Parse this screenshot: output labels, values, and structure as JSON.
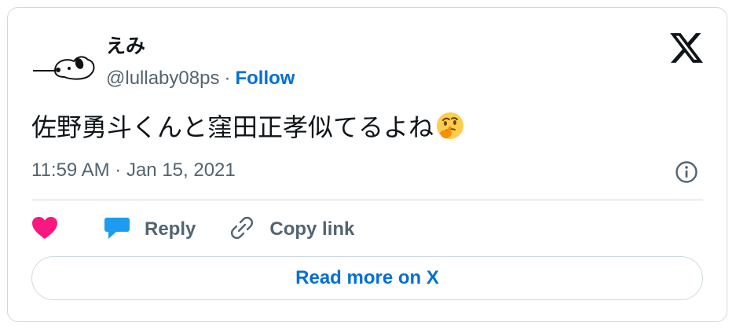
{
  "author": {
    "name": "えみ",
    "handle": "@lullaby08ps",
    "separator": "·",
    "follow_label": "Follow"
  },
  "tweet": {
    "text": "佐野勇斗くんと窪田正孝似てるよね",
    "emoji_icon": "thinking-face-icon",
    "timestamp": "11:59 AM · Jan 15, 2021"
  },
  "actions": {
    "like_icon": "heart-icon",
    "reply_label": "Reply",
    "copy_label": "Copy link"
  },
  "read_more_label": "Read more on X",
  "colors": {
    "accent": "#006fd6",
    "like": "#f91880",
    "reply_icon": "#1d9bf0",
    "muted": "#536471",
    "border": "#cfd9de"
  }
}
